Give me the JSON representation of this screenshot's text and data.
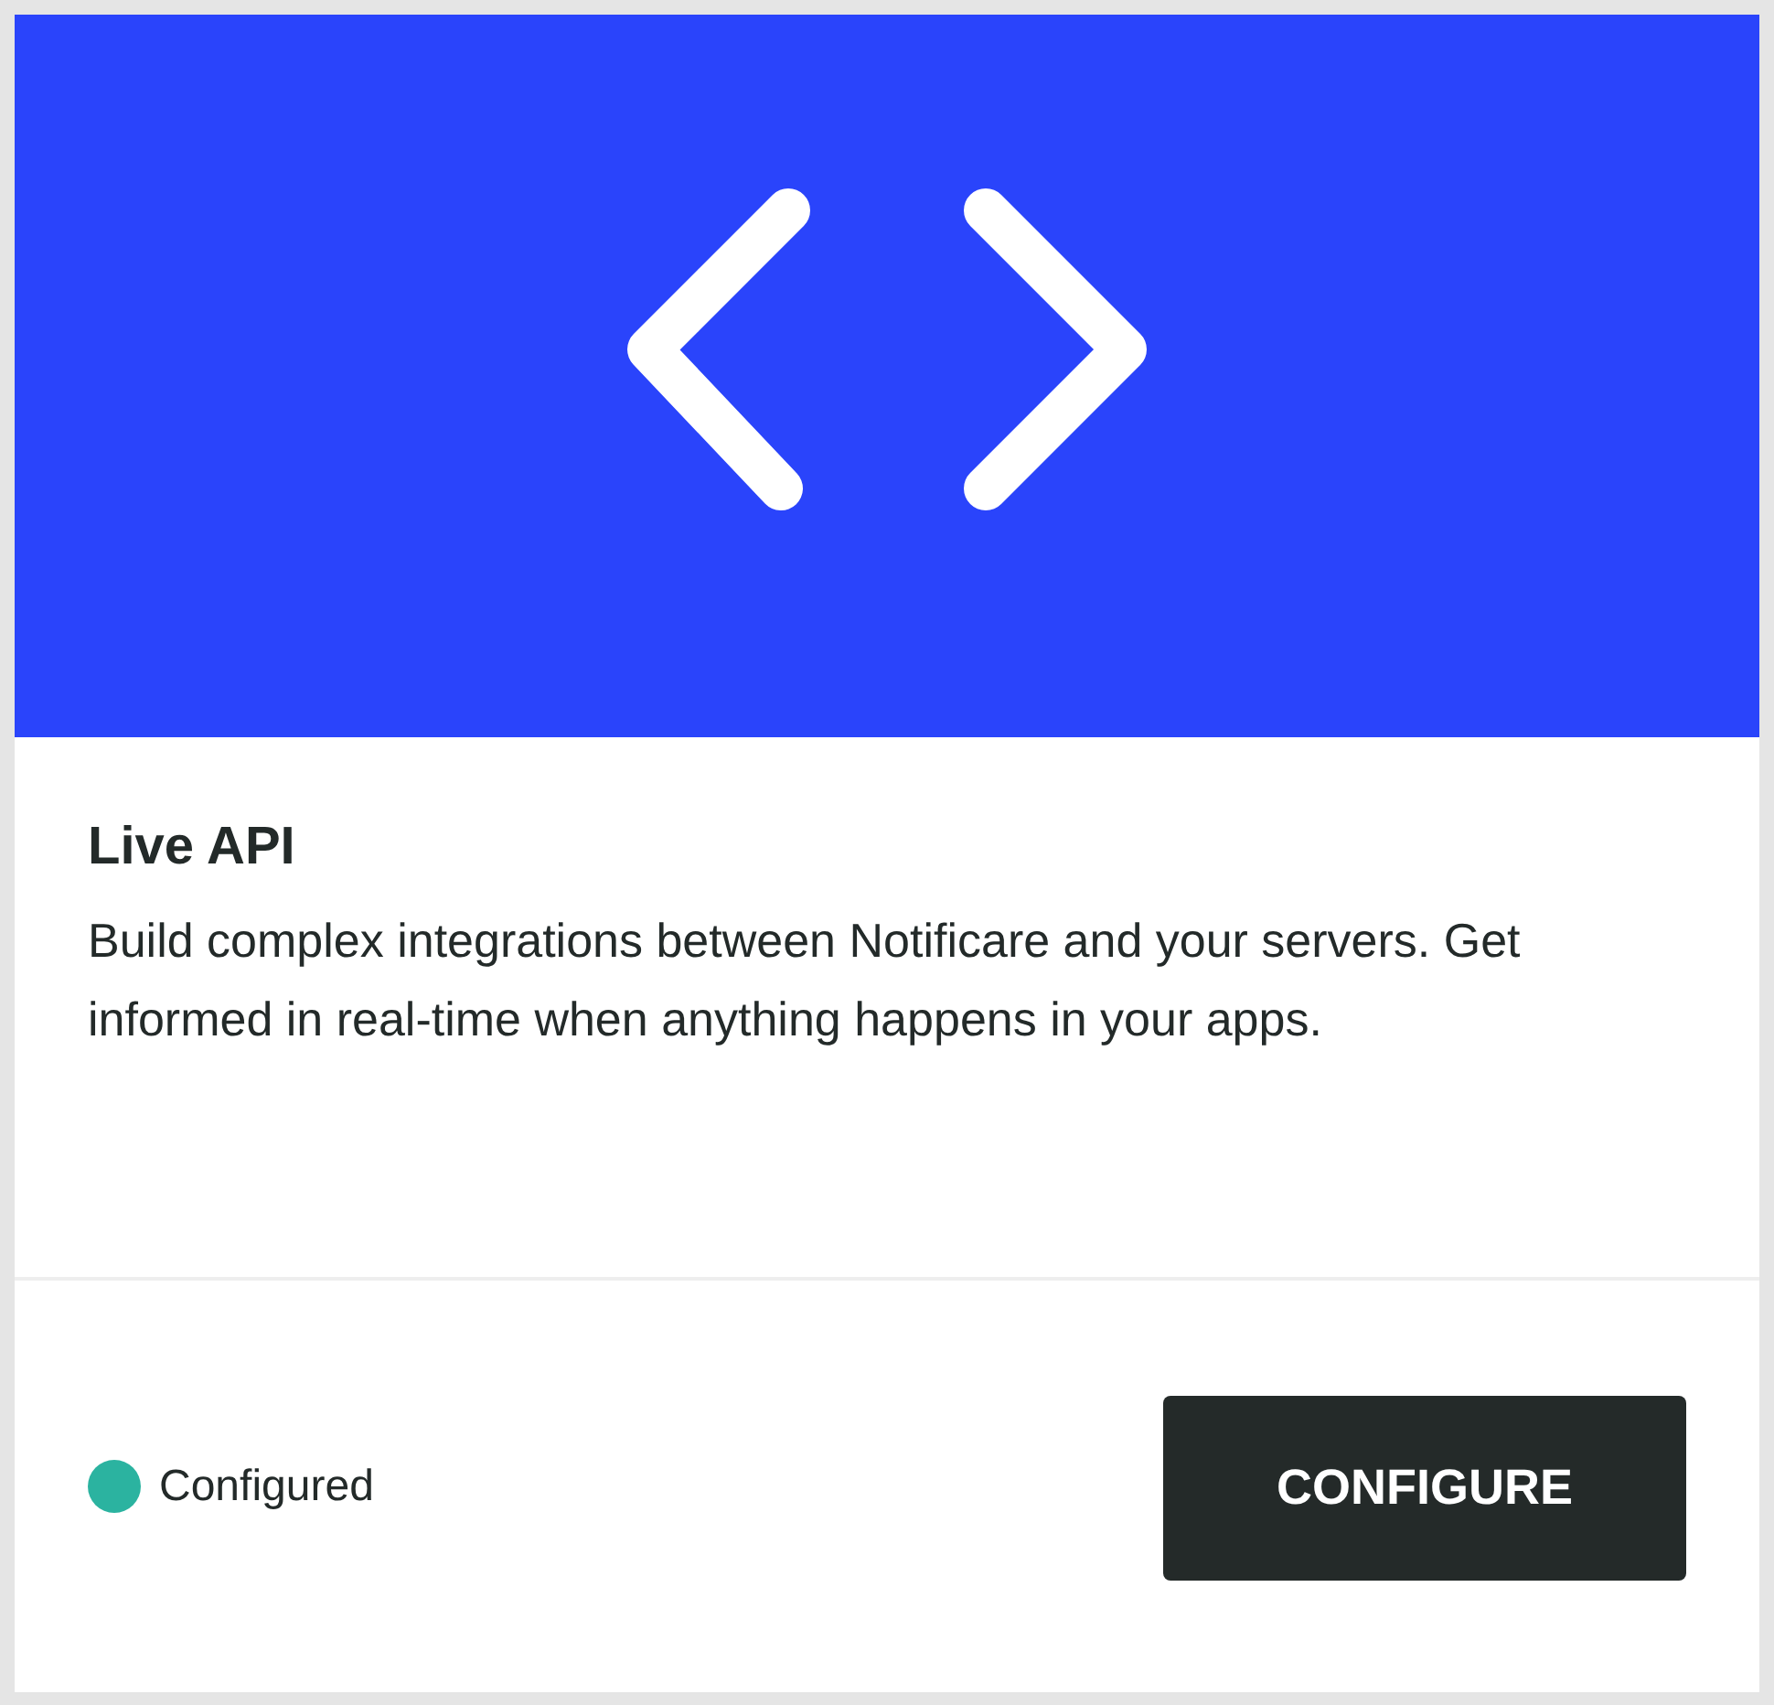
{
  "card": {
    "title": "Live API",
    "description": "Build complex integrations between Notificare and your servers. Get informed in real-time when anything happens in your apps.",
    "status": {
      "configured": true,
      "label": "Configured"
    },
    "button": "CONFIGURE"
  }
}
